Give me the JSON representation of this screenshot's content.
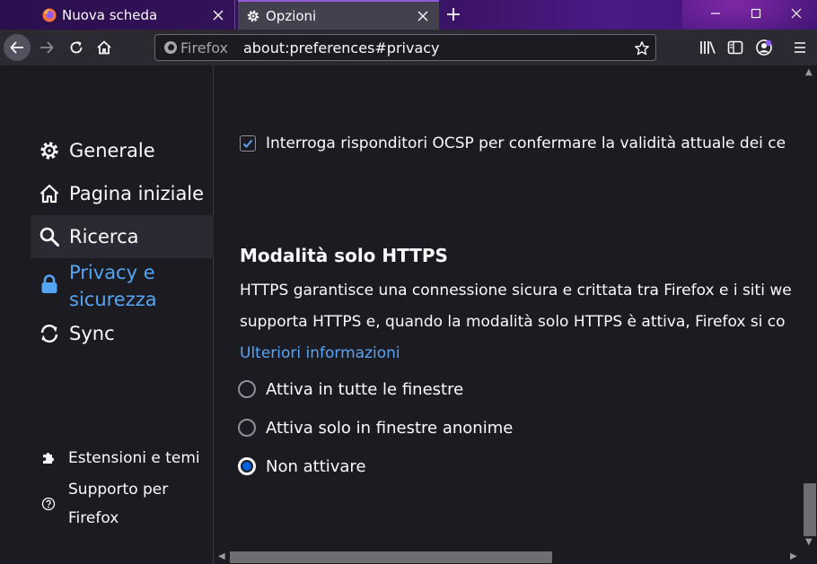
{
  "tabs": [
    {
      "label": "Nuova scheda",
      "icon": "firefox-icon"
    },
    {
      "label": "Opzioni",
      "icon": "gear-icon"
    }
  ],
  "urlbar": {
    "identity_label": "Firefox",
    "url": "about:preferences#privacy"
  },
  "sidebar": {
    "categories": [
      {
        "label": "Generale",
        "icon": "gear-icon"
      },
      {
        "label": "Pagina iniziale",
        "icon": "home-icon"
      },
      {
        "label": "Ricerca",
        "icon": "search-icon"
      },
      {
        "label_line1": "Privacy e",
        "label_line2": "sicurezza",
        "icon": "lock-icon"
      },
      {
        "label": "Sync",
        "icon": "sync-icon"
      }
    ],
    "footer": [
      {
        "label": "Estensioni e temi",
        "icon": "puzzle-icon"
      },
      {
        "label_line1": "Supporto per",
        "label_line2": "Firefox",
        "icon": "help-icon"
      }
    ]
  },
  "content": {
    "ocsp_label": "Interroga risponditori OCSP per confermare la validità attuale dei ce",
    "https_title": "Modalità solo HTTPS",
    "https_desc_line1": "HTTPS garantisce una connessione sicura e crittata tra Firefox e i siti we",
    "https_desc_line2": "supporta HTTPS e, quando la modalità solo HTTPS è attiva, Firefox si co",
    "learn_more": "Ulteriori informazioni",
    "options": [
      {
        "label": "Attiva in tutte le finestre",
        "checked": false
      },
      {
        "label": "Attiva solo in finestre anonime",
        "checked": false
      },
      {
        "label": "Non attivare",
        "checked": true
      }
    ]
  },
  "colors": {
    "accent": "#54a6f5",
    "radio_selected": "#0060df",
    "background": "#1c1b22",
    "toolbar": "#2b2a33"
  }
}
